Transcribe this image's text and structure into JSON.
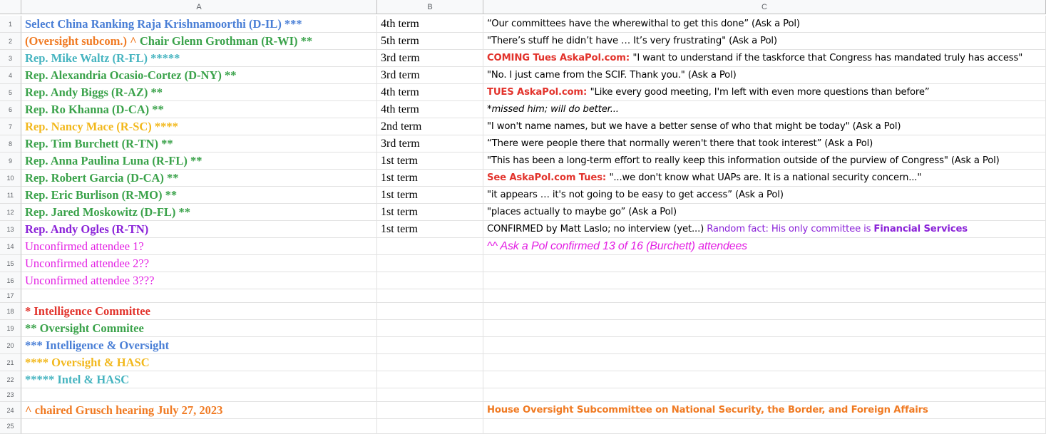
{
  "columns": [
    "A",
    "B",
    "C"
  ],
  "colors": {
    "blue": "#4a7fd6",
    "green": "#3aa24a",
    "orange": "#f07a22",
    "teal": "#46b4c0",
    "yellow": "#f2b81c",
    "purple": "#8a22d8",
    "magenta": "#e320e3",
    "red": "#e2332c"
  },
  "rows": [
    {
      "n": "1",
      "a": [
        {
          "t": "Select China Ranking Raja Krishnamoorthi (D-IL) ***",
          "c": "blue"
        }
      ],
      "b": "4th term",
      "c": [
        {
          "t": "“Our committees have the wherewithal to get this done” (Ask a Pol)"
        }
      ]
    },
    {
      "n": "2",
      "a": [
        {
          "t": "(Oversight subcom.) ^ ",
          "c": "orange"
        },
        {
          "t": "Chair Glenn Grothman (R-WI) **",
          "c": "green"
        }
      ],
      "b": "5th term",
      "c": [
        {
          "t": "\"There’s stuff he didn’t have … It’s very frustrating\" (Ask a Pol)"
        }
      ]
    },
    {
      "n": "3",
      "a": [
        {
          "t": "Rep. Mike Waltz (R-FL) *****",
          "c": "teal"
        }
      ],
      "b": "3rd term",
      "c": [
        {
          "t": "COMING Tues AskaPol.com: ",
          "c": "red",
          "b": true
        },
        {
          "t": "\"I want to understand if the taskforce that Congress has mandated truly has access\""
        }
      ]
    },
    {
      "n": "4",
      "a": [
        {
          "t": "Rep. Alexandria Ocasio-Cortez (D-NY) **",
          "c": "green"
        }
      ],
      "b": "3rd term",
      "c": [
        {
          "t": "\"No. I just came from the SCIF. Thank you.\" (Ask a Pol)"
        }
      ]
    },
    {
      "n": "5",
      "a": [
        {
          "t": "Rep. Andy Biggs (R-AZ) **",
          "c": "green"
        }
      ],
      "b": "4th term",
      "c": [
        {
          "t": "TUES AskaPol.com: ",
          "c": "red",
          "b": true
        },
        {
          "t": "\"Like every good meeting, I'm left with even more questions than before”"
        }
      ]
    },
    {
      "n": "6",
      "a": [
        {
          "t": "Rep. Ro Khanna (D-CA) **",
          "c": "green"
        }
      ],
      "b": "4th term",
      "c": [
        {
          "t": "*missed him; will do better...",
          "i": true
        }
      ]
    },
    {
      "n": "7",
      "a": [
        {
          "t": "Rep. Nancy Mace (R-SC) ****",
          "c": "yellow"
        }
      ],
      "b": "2nd term",
      "c": [
        {
          "t": "\"I won't name names, but we have a better sense of who that might be today\" (Ask a Pol)"
        }
      ]
    },
    {
      "n": "8",
      "a": [
        {
          "t": "Rep. Tim Burchett (R-TN) **",
          "c": "green"
        }
      ],
      "b": "3rd term",
      "c": [
        {
          "t": "“There were people there that normally weren't there that took interest” (Ask a Pol)"
        }
      ]
    },
    {
      "n": "9",
      "a": [
        {
          "t": "Rep. Anna Paulina Luna (R-FL) **",
          "c": "green"
        }
      ],
      "b": "1st term",
      "c": [
        {
          "t": " \"This has been a long-term effort to really keep this information outside of the purview of Congress\" (Ask a Pol)"
        }
      ]
    },
    {
      "n": "10",
      "a": [
        {
          "t": "Rep. Robert Garcia (D-CA) **",
          "c": "green"
        }
      ],
      "b": "1st term",
      "c": [
        {
          "t": "See AskaPol.com Tues: ",
          "c": "red",
          "b": true
        },
        {
          "t": "\"...we don't know what UAPs are. It is a national security concern...\""
        }
      ]
    },
    {
      "n": "11",
      "a": [
        {
          "t": "Rep. Eric Burlison (R-MO) **",
          "c": "green"
        }
      ],
      "b": "1st term",
      "c": [
        {
          "t": "\"it appears … it's not going to be easy to get access” (Ask a Pol)"
        }
      ]
    },
    {
      "n": "12",
      "a": [
        {
          "t": "Rep. Jared Moskowitz (D-FL) **",
          "c": "green"
        }
      ],
      "b": "1st term",
      "c": [
        {
          "t": "\"places actually to maybe go” (Ask a Pol)"
        }
      ]
    },
    {
      "n": "13",
      "a": [
        {
          "t": "Rep. Andy Ogles (R-TN)",
          "c": "purple"
        }
      ],
      "b": "1st term",
      "c": [
        {
          "t": "CONFIRMED by Matt Laslo; no interview (yet...) "
        },
        {
          "t": "Random fact: ",
          "c": "purple"
        },
        {
          "t": "His only committee is ",
          "c": "purple"
        },
        {
          "t": "Financial Services",
          "c": "purple",
          "b": true
        }
      ]
    },
    {
      "n": "14",
      "a": [
        {
          "t": "Unconfirmed attendee 1?",
          "c": "magenta",
          "norm": true
        }
      ],
      "b": "",
      "c": [
        {
          "t": "^^ Ask a Pol confirmed 13 of 16 (Burchett) attendees",
          "c": "magenta",
          "i": true,
          "big": true
        }
      ]
    },
    {
      "n": "15",
      "a": [
        {
          "t": "Unconfirmed attendee 2??",
          "c": "magenta",
          "norm": true
        }
      ],
      "b": "",
      "c": []
    },
    {
      "n": "16",
      "a": [
        {
          "t": "Unconfirmed attendee 3???",
          "c": "magenta",
          "norm": true
        }
      ],
      "b": "",
      "c": []
    },
    {
      "n": "17",
      "a": [],
      "b": "",
      "c": []
    },
    {
      "n": "18",
      "a": [
        {
          "t": "* Intelligence Committee",
          "c": "red"
        }
      ],
      "b": "",
      "c": []
    },
    {
      "n": "19",
      "a": [
        {
          "t": "** Oversight Commitee",
          "c": "green"
        }
      ],
      "b": "",
      "c": []
    },
    {
      "n": "20",
      "a": [
        {
          "t": "*** Intelligence & Oversight",
          "c": "blue"
        }
      ],
      "b": "",
      "c": []
    },
    {
      "n": "21",
      "a": [
        {
          "t": "**** Oversight & HASC",
          "c": "yellow"
        }
      ],
      "b": "",
      "c": []
    },
    {
      "n": "22",
      "a": [
        {
          "t": "***** Intel & HASC",
          "c": "teal"
        }
      ],
      "b": "",
      "c": []
    },
    {
      "n": "23",
      "a": [],
      "b": "",
      "c": []
    },
    {
      "n": "24",
      "a": [
        {
          "t": "^ chaired Grusch hearing July 27, 2023",
          "c": "orange"
        }
      ],
      "b": "",
      "c": [
        {
          "t": "House Oversight Subcommittee on National Security, the Border, and Foreign Affairs",
          "c": "orange",
          "b": true
        }
      ]
    },
    {
      "n": "25",
      "a": [],
      "b": "",
      "c": []
    }
  ]
}
